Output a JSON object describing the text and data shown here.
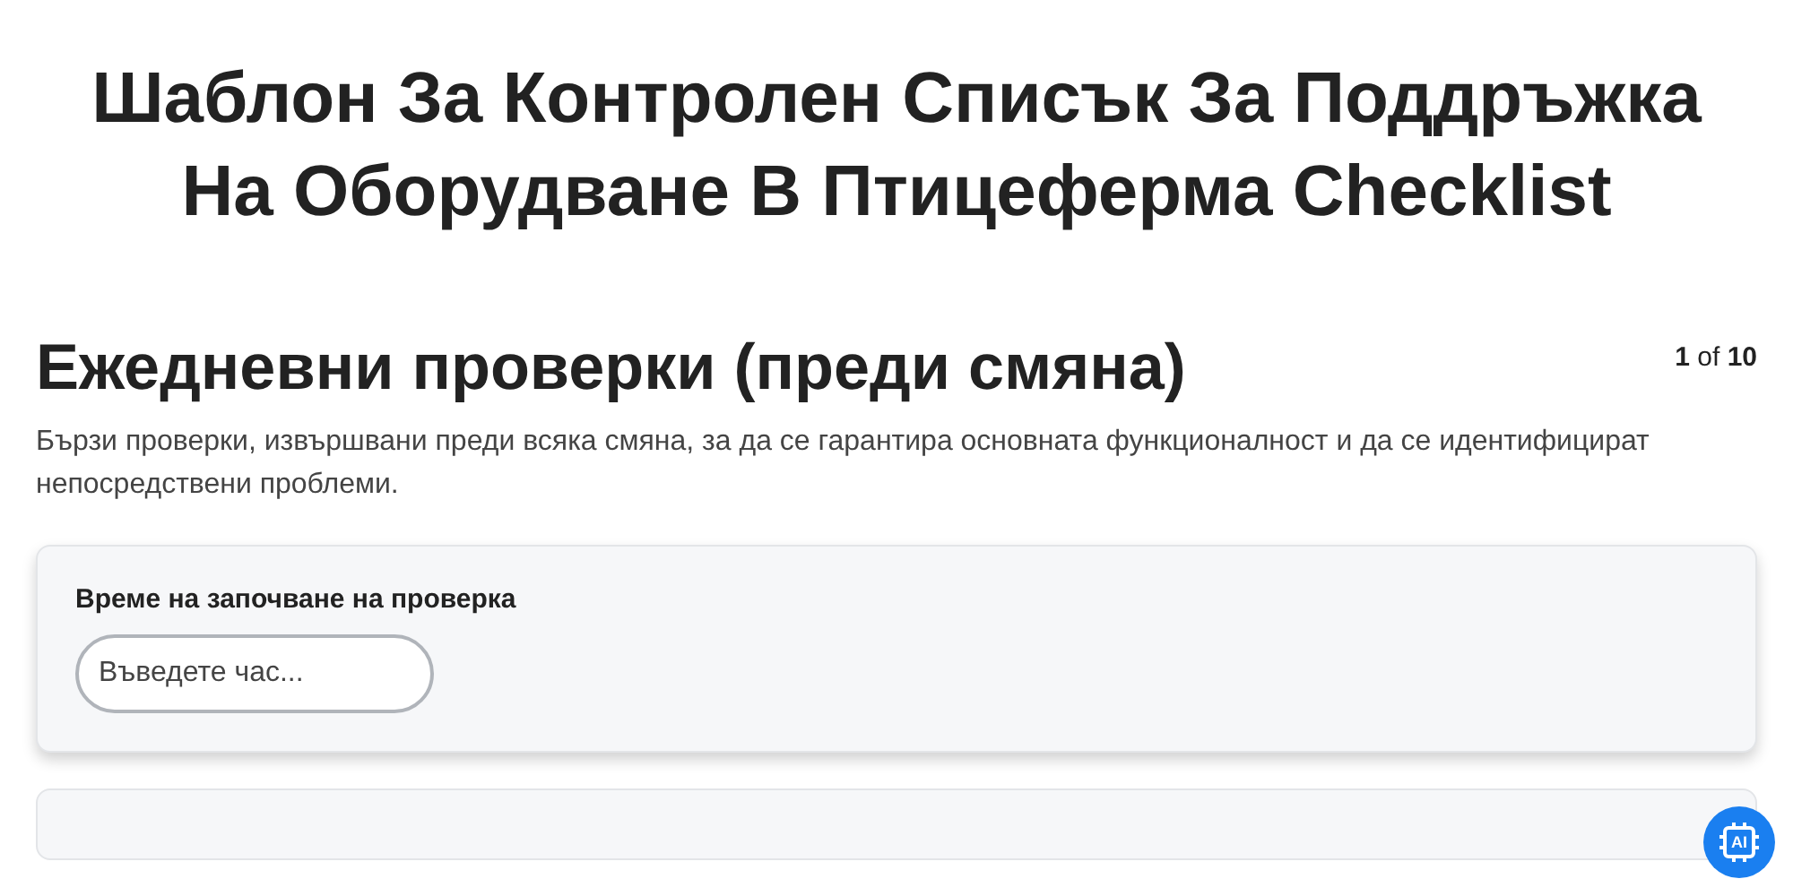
{
  "title": "Шаблон За Контролен Списък За Поддръжка На Оборудване В Птицеферма Checklist",
  "section": {
    "heading": "Ежедневни проверки (преди смяна)",
    "pager": "**1** of **10**",
    "description": "Бързи проверки, извършвани преди всяка смяна, за да се гарантира основната функционалност и да се идентифицират непосредствени проблеми."
  },
  "fields": [
    {
      "label": "Време на започване на проверка",
      "placeholder": "Въведете час..."
    }
  ],
  "ai_button": {
    "label": "AI"
  }
}
